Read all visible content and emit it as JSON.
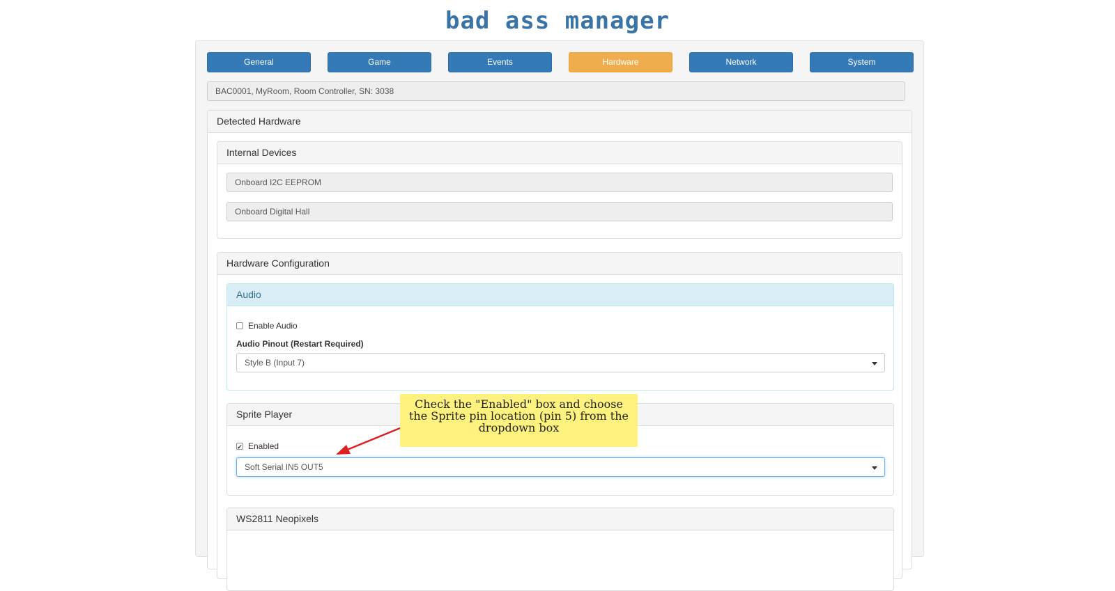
{
  "app": {
    "logo_text": "bad ass manager"
  },
  "tabs": [
    {
      "label": "General"
    },
    {
      "label": "Game"
    },
    {
      "label": "Events"
    },
    {
      "label": "Hardware",
      "active": true
    },
    {
      "label": "Network"
    },
    {
      "label": "System"
    }
  ],
  "device_info": "BAC0001, MyRoom, Room Controller, SN: 3038",
  "detected_hardware": {
    "title": "Detected Hardware",
    "internal_devices": {
      "title": "Internal Devices",
      "items": [
        "Onboard I2C EEPROM",
        "Onboard Digital Hall"
      ]
    }
  },
  "hardware_config": {
    "title": "Hardware Configuration",
    "audio": {
      "title": "Audio",
      "enable_label": "Enable Audio",
      "enabled": false,
      "pinout_label": "Audio Pinout (Restart Required)",
      "pinout_value": "Style B (Input 7)"
    },
    "sprite_player": {
      "title": "Sprite Player",
      "enabled_label": "Enabled",
      "enabled": true,
      "pin_value": "Soft Serial IN5 OUT5"
    },
    "neopixels": {
      "title": "WS2811 Neopixels"
    }
  },
  "callout": {
    "text": "Check the \"Enabled\" box and choose the Sprite pin location (pin 5) from the dropdown box",
    "color": "#fff27f",
    "arrow_color": "#e02020"
  },
  "colors": {
    "primary": "#337ab7",
    "active_tab": "#f0ad4e",
    "logo": "#3a73a6",
    "info_heading": "#d9edf7"
  }
}
